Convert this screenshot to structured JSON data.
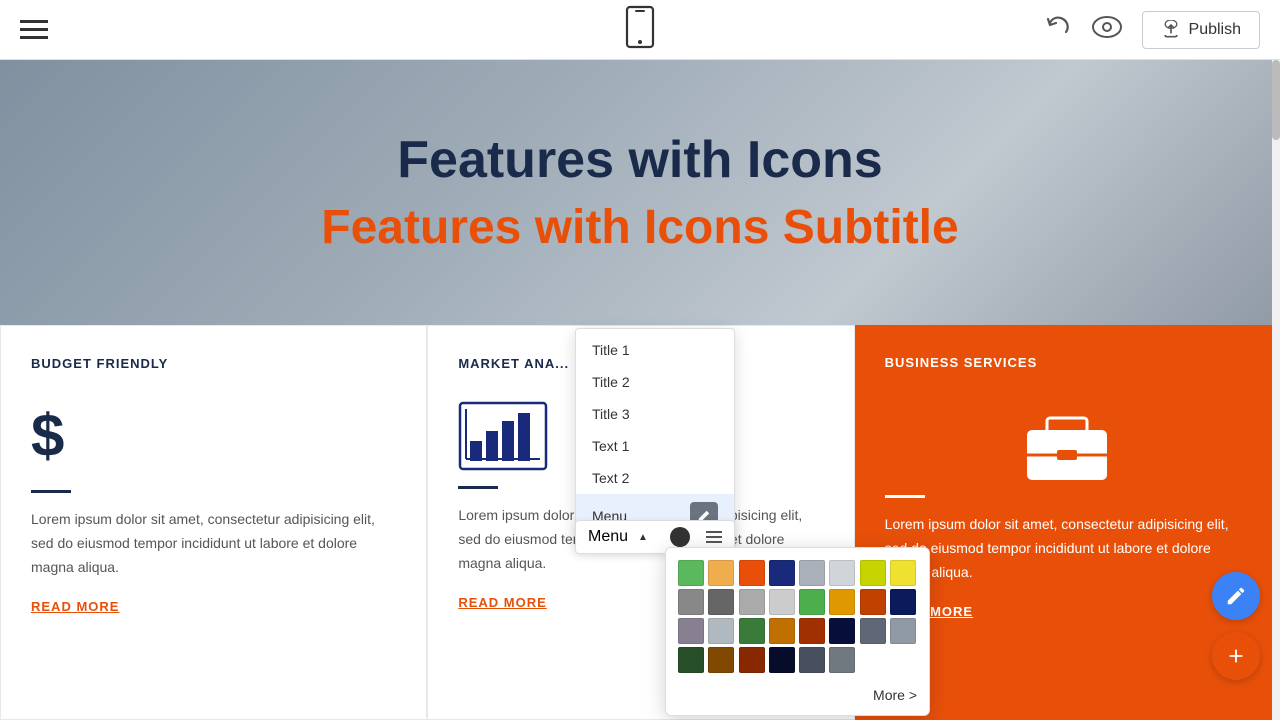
{
  "topbar": {
    "publish_label": "Publish",
    "mobile_icon": "📱"
  },
  "hero": {
    "title": "Features with Icons",
    "subtitle": "Features with Icons Subtitle"
  },
  "cards": [
    {
      "id": "budget",
      "title": "BUDGET FRIENDLY",
      "icon_type": "dollar",
      "text": "Lorem ipsum dolor sit amet, consectetur adipisicing elit, sed do eiusmod tempor incididunt ut labore et dolore magna aliqua.",
      "read_more": "READ MORE"
    },
    {
      "id": "market",
      "title": "MARKET ANA...",
      "icon_type": "chart",
      "text": "Lorem ipsum dolor sit amet, consectetur adipisicing elit, sed do eiusmod tempor incididunt ut labore et dolore magna aliqua.",
      "read_more": "READ MORE"
    },
    {
      "id": "business",
      "title": "BUSINESS SERVICES",
      "icon_type": "briefcase",
      "text": "Lorem ipsum dolor sit amet, consectetur adipisicing elit, sed do eiusmod tempor incididunt ut labore et dolore magna aliqua.",
      "read_more": "READ MORE"
    }
  ],
  "dropdown": {
    "items": [
      {
        "label": "Title 1",
        "active": false
      },
      {
        "label": "Title 2",
        "active": false
      },
      {
        "label": "Title 3",
        "active": false
      },
      {
        "label": "Text 1",
        "active": false
      },
      {
        "label": "Text 2",
        "active": false
      },
      {
        "label": "Menu",
        "active": true
      }
    ]
  },
  "menu_bar": {
    "label": "Menu",
    "chevron": "▲"
  },
  "color_picker": {
    "more_label": "More >",
    "colors": [
      "#5cb85c",
      "#f0ad4e",
      "#e8500a",
      "#1a2a7a",
      "#aab0ba",
      "#d0d5da",
      "#c8d400",
      "#f0e030",
      "#888888",
      "#666666",
      "#aaaaaa",
      "#cccccc",
      "#4cae4c",
      "#e09800",
      "#c04000",
      "#0a1a5a",
      "#888090",
      "#b0b8c0",
      "#3a7a3a",
      "#c07000",
      "#a03000",
      "#080e3a",
      "#606878",
      "#909aa5",
      "#285028",
      "#804800",
      "#882800",
      "#060c2a",
      "#485060",
      "#707880"
    ]
  }
}
